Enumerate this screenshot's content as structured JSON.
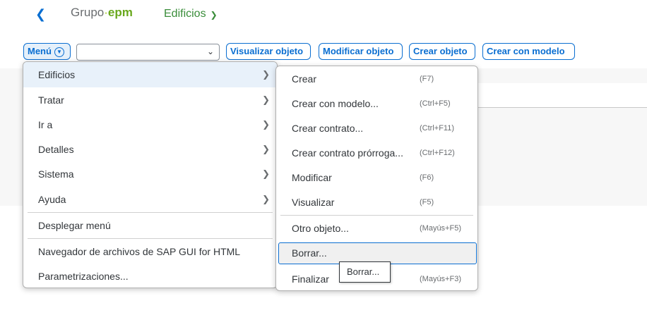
{
  "shell": {
    "back_icon": "chevron-left-icon",
    "logo": {
      "grupo": "Grupo",
      "dot": "·",
      "epm": "epm"
    },
    "title": "Edificios",
    "title_icon": "chevron-down-icon"
  },
  "toolbar": {
    "menu_label": "Menú",
    "menu_icon": "chevron-down-circle-icon",
    "combo_value": "",
    "combo_icon": "chevron-down-icon",
    "buttons": [
      "Visualizar objeto",
      "Modificar objeto",
      "Crear objeto",
      "Crear con modelo"
    ]
  },
  "main_menu": {
    "items": [
      {
        "label": "Edificios",
        "submenu": true
      },
      {
        "label": "Tratar",
        "submenu": true
      },
      {
        "label": "Ir a",
        "submenu": true
      },
      {
        "label": "Detalles",
        "submenu": true
      },
      {
        "label": "Sistema",
        "submenu": true
      },
      {
        "label": "Ayuda",
        "submenu": true
      },
      {
        "label": "Desplegar menú",
        "submenu": false
      },
      {
        "label": "Navegador de archivos de SAP GUI for HTML",
        "submenu": false
      },
      {
        "label": "Parametrizaciones...",
        "submenu": false
      }
    ],
    "chevron_icon": "chevron-right-icon"
  },
  "sub_menu": {
    "items": [
      {
        "label": "Crear",
        "shortcut": "(F7)"
      },
      {
        "label": "Crear con modelo...",
        "shortcut": "(Ctrl+F5)"
      },
      {
        "label": "Crear contrato...",
        "shortcut": "(Ctrl+F11)"
      },
      {
        "label": "Crear contrato prórroga...",
        "shortcut": "(Ctrl+F12)"
      },
      {
        "label": "Modificar",
        "shortcut": "(F6)"
      },
      {
        "label": "Visualizar",
        "shortcut": "(F5)"
      },
      {
        "label": "Otro objeto...",
        "shortcut": "(Mayús+F5)"
      },
      {
        "label": "Borrar...",
        "shortcut": ""
      },
      {
        "label": "Finalizar",
        "shortcut": "(Mayús+F3)"
      }
    ]
  },
  "tooltip": {
    "text": "Borrar..."
  },
  "colors": {
    "accent": "#0a6ed1",
    "brand_green": "#69a81d",
    "title_green": "#3a8d3a"
  }
}
